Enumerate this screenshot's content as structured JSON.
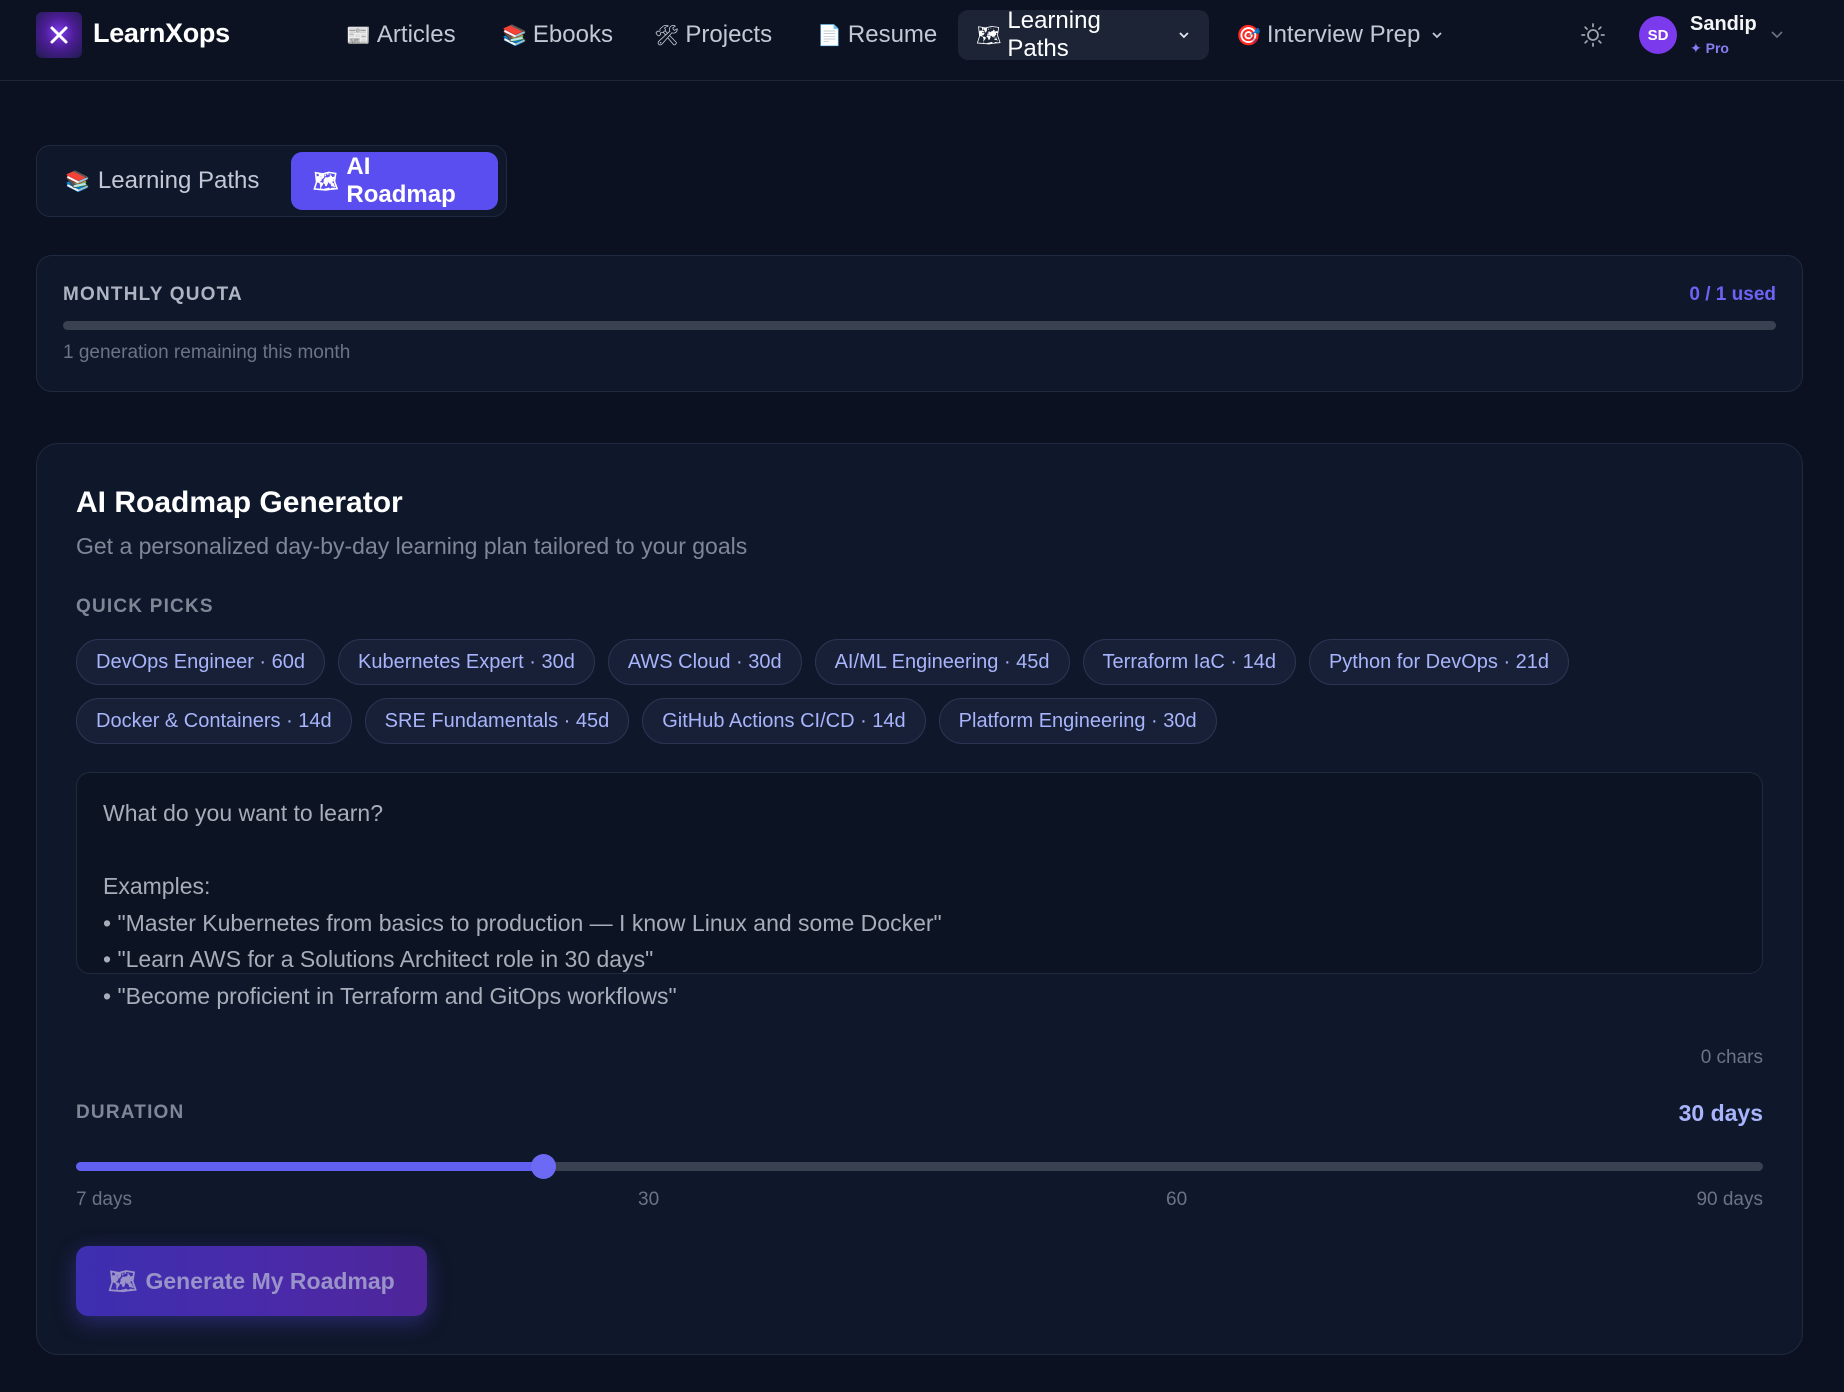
{
  "brand": {
    "name": "LearnXops"
  },
  "nav": {
    "articles": "Articles",
    "ebooks": "Ebooks",
    "projects": "Projects",
    "resume": "Resume",
    "learning_paths": "Learning Paths",
    "interview_prep": "Interview Prep"
  },
  "user": {
    "initials": "SD",
    "name": "Sandip",
    "plan": "✦ Pro"
  },
  "tabs": {
    "learning_paths": "Learning Paths",
    "ai_roadmap": "AI Roadmap"
  },
  "quota": {
    "title": "MONTHLY QUOTA",
    "used_label": "0 / 1 used",
    "used": 0,
    "limit": 1,
    "remaining_text": "1 generation remaining this month"
  },
  "generator": {
    "title": "AI Roadmap Generator",
    "subtitle": "Get a personalized day-by-day learning plan tailored to your goals",
    "quick_picks_label": "QUICK PICKS",
    "quick_picks": [
      "DevOps Engineer · 60d",
      "Kubernetes Expert · 30d",
      "AWS Cloud · 30d",
      "AI/ML Engineering · 45d",
      "Terraform IaC · 14d",
      "Python for DevOps · 21d",
      "Docker & Containers · 14d",
      "SRE Fundamentals · 45d",
      "GitHub Actions CI/CD · 14d",
      "Platform Engineering · 30d"
    ],
    "input_placeholder": "What do you want to learn?\n\nExamples:\n• \"Master Kubernetes from basics to production — I know Linux and some Docker\"\n• \"Learn AWS for a Solutions Architect role in 30 days\"\n• \"Become proficient in Terraform and GitOps workflows\"",
    "input_value": "",
    "char_count": "0 chars",
    "duration_label": "DURATION",
    "duration_value_label": "30 days",
    "duration": {
      "min": 7,
      "max": 90,
      "value": 30
    },
    "ticks": [
      "7 days",
      "30",
      "60",
      "90 days"
    ],
    "generate_label": "Generate My Roadmap"
  },
  "colors": {
    "accent": "#5b4ef0",
    "background": "#0b1120",
    "card": "#0f172a"
  }
}
